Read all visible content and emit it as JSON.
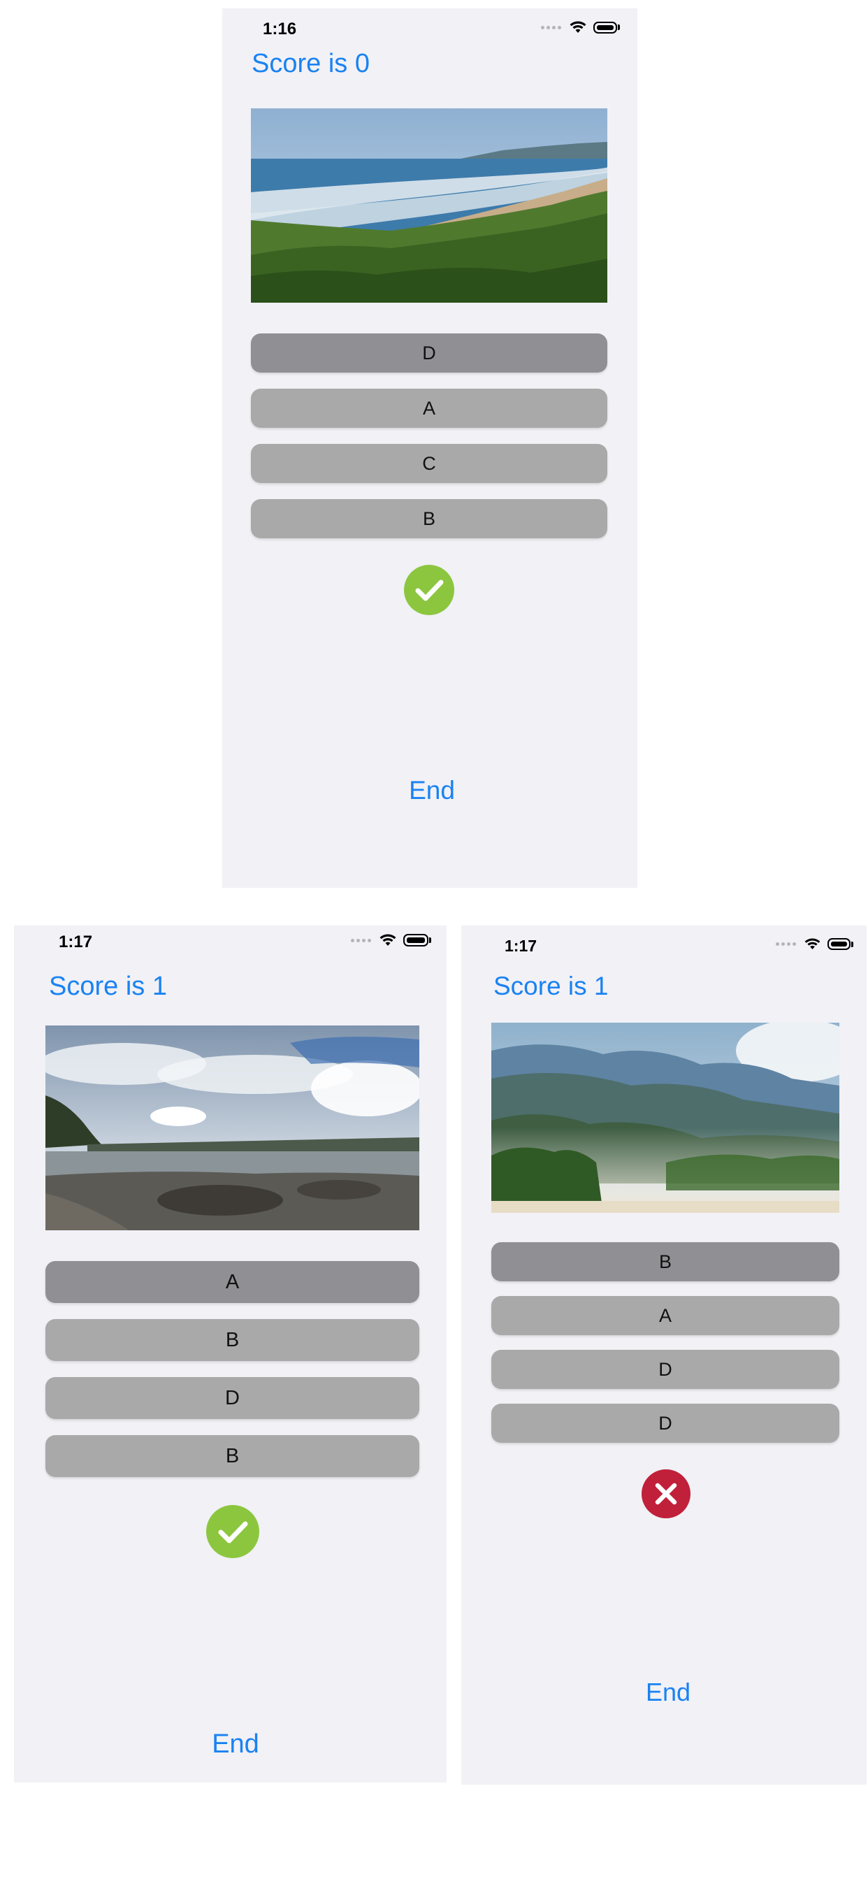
{
  "colors": {
    "accent": "#1a82f2",
    "correct": "#8cc63f",
    "wrong": "#c0203a",
    "button": "#a9a9a9",
    "button_selected": "#909094"
  },
  "screens": [
    {
      "time": "1:16",
      "score": "Score is 0",
      "image": "coastline-icon",
      "answers": [
        "D",
        "A",
        "C",
        "B"
      ],
      "result": "checkmark-icon",
      "end_label": "End"
    },
    {
      "time": "1:17",
      "score": "Score is 1",
      "image": "rocky-beach-icon",
      "answers": [
        "A",
        "B",
        "D",
        "B"
      ],
      "result": "checkmark-icon",
      "end_label": "End"
    },
    {
      "time": "1:17",
      "score": "Score is 1",
      "image": "misty-mountains-icon",
      "answers": [
        "B",
        "A",
        "D",
        "D"
      ],
      "result": "x-mark-icon",
      "end_label": "End"
    }
  ]
}
